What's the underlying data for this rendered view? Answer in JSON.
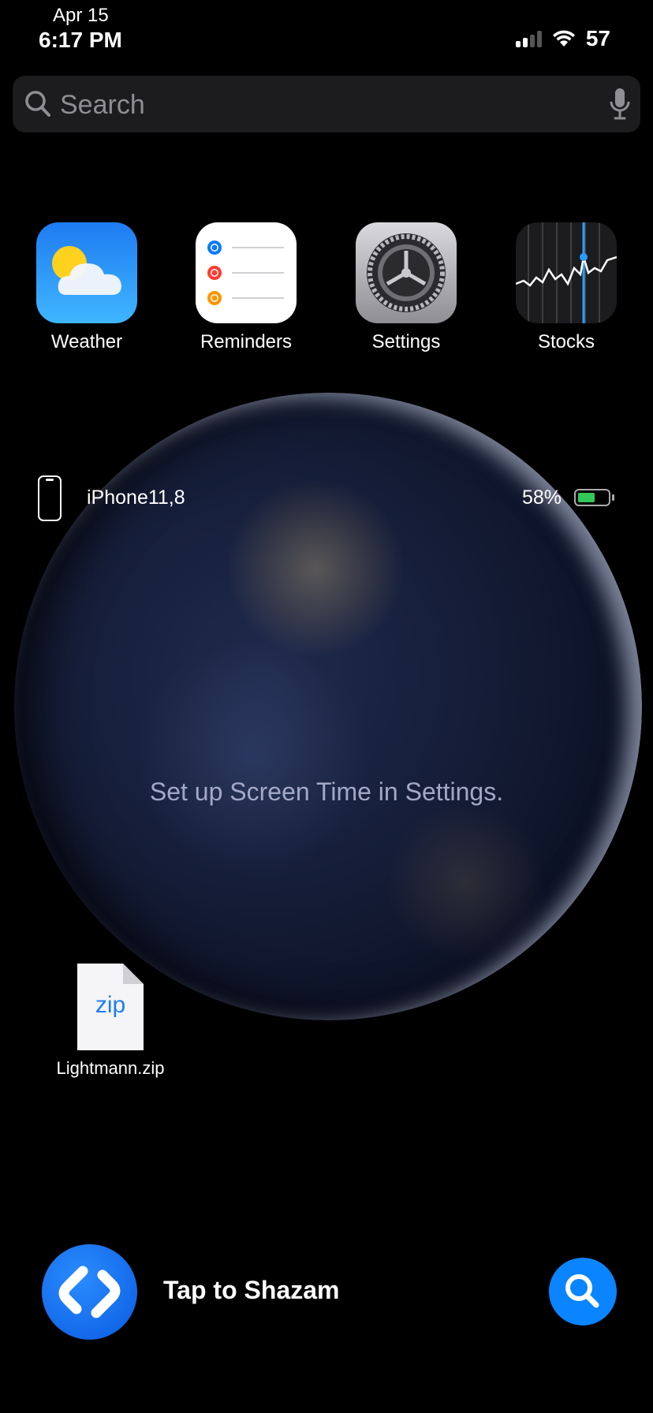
{
  "status_bar": {
    "date": "Apr 15",
    "time": "6:17 PM",
    "battery": "57",
    "icons": [
      "cellular-signal-icon",
      "wifi-icon"
    ]
  },
  "search": {
    "placeholder": "Search",
    "icons": [
      "search-icon",
      "microphone-icon"
    ]
  },
  "apps": [
    {
      "label": "Weather",
      "icon": "weather-icon"
    },
    {
      "label": "Reminders",
      "icon": "reminders-icon"
    },
    {
      "label": "Settings",
      "icon": "settings-gear-icon"
    },
    {
      "label": "Stocks",
      "icon": "stocks-icon"
    }
  ],
  "battery_widget": {
    "device_name": "iPhone11,8",
    "percent_text": "58%",
    "level": 0.58,
    "fill_color": "#34c759"
  },
  "screen_time": {
    "message": "Set up Screen Time in Settings."
  },
  "file": {
    "icon_text": "zip",
    "name": "Lightmann.zip"
  },
  "shazam": {
    "label": "Tap to Shazam",
    "brand_color": "#0a84ff"
  }
}
